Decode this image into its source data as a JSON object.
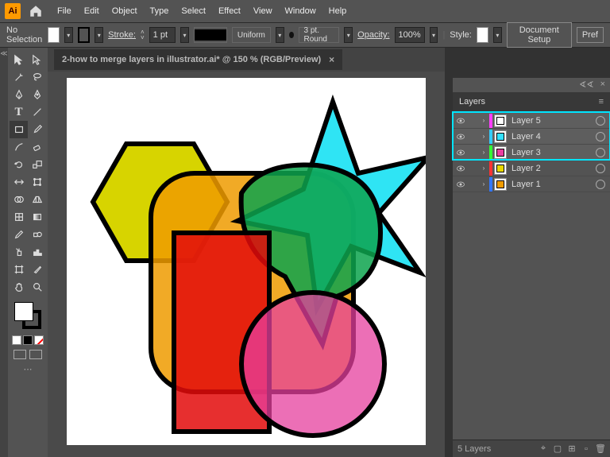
{
  "menubar": {
    "items": [
      "File",
      "Edit",
      "Object",
      "Type",
      "Select",
      "Effect",
      "View",
      "Window",
      "Help"
    ]
  },
  "controlbar": {
    "selection_state": "No Selection",
    "stroke_label": "Stroke:",
    "stroke_value": "1 pt",
    "profile": "Uniform",
    "brush": "3 pt. Round",
    "opacity_label": "Opacity:",
    "opacity_value": "100%",
    "style_label": "Style:",
    "doc_setup": "Document Setup",
    "preferences": "Pref"
  },
  "document": {
    "tab_title": "2-how to merge layers in illustrator.ai* @ 150 % (RGB/Preview)"
  },
  "layers_panel": {
    "title": "Layers",
    "footer_count": "5 Layers",
    "layers": [
      {
        "name": "Layer 5",
        "color_strip": "#ff3eff",
        "thumb_color": "#ffffff",
        "selected": true
      },
      {
        "name": "Layer 4",
        "color_strip": "#33ccff",
        "thumb_color": "#33e0ff",
        "selected": true
      },
      {
        "name": "Layer 3",
        "color_strip": "#33ff33",
        "thumb_color": "#ec3fa0",
        "selected": true
      },
      {
        "name": "Layer 2",
        "color_strip": "#ff3333",
        "thumb_color": "#e8d800",
        "selected": false
      },
      {
        "name": "Layer 1",
        "color_strip": "#3377ff",
        "thumb_color": "#ef9b00",
        "selected": false
      }
    ]
  },
  "shapes": {
    "hexagon_color": "#d7d400",
    "roundrect_color": "#ef9b00",
    "star_color": "#18e1f3",
    "leaf_color": "#0da34d",
    "rect_color": "#e30b0b",
    "circle_color": "#e53f9e"
  }
}
